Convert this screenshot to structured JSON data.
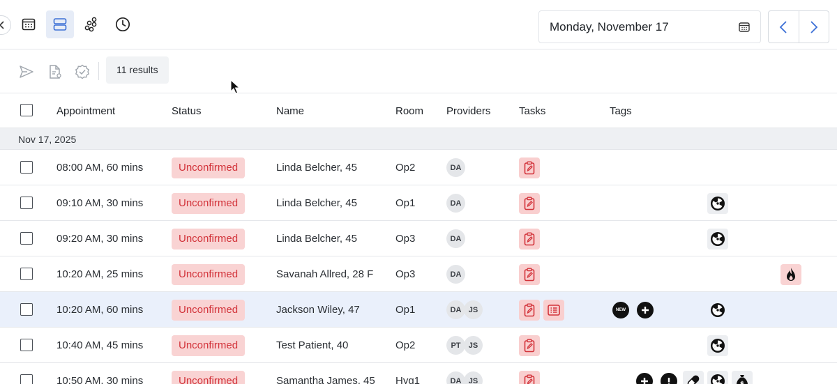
{
  "toolbar": {
    "date_label": "Monday, November 17"
  },
  "actions": {
    "results_label": "11 results"
  },
  "table": {
    "columns": [
      "Appointment",
      "Status",
      "Name",
      "Room",
      "Providers",
      "Tasks",
      "Tags"
    ],
    "group_label": "Nov 17, 2025",
    "rows": [
      {
        "appointment": "08:00 AM, 60 mins",
        "status": "Unconfirmed",
        "name": "Linda Belcher, 45",
        "room": "Op2",
        "providers": [
          "DA"
        ]
      },
      {
        "appointment": "09:10 AM, 30 mins",
        "status": "Unconfirmed",
        "name": "Linda Belcher, 45",
        "room": "Op1",
        "providers": [
          "DA"
        ]
      },
      {
        "appointment": "09:20 AM, 30 mins",
        "status": "Unconfirmed",
        "name": "Linda Belcher, 45",
        "room": "Op3",
        "providers": [
          "DA"
        ]
      },
      {
        "appointment": "10:20 AM, 25 mins",
        "status": "Unconfirmed",
        "name": "Savanah Allred, 28 F",
        "room": "Op3",
        "providers": [
          "DA"
        ]
      },
      {
        "appointment": "10:20 AM, 60 mins",
        "status": "Unconfirmed",
        "name": "Jackson Wiley, 47",
        "room": "Op1",
        "providers": [
          "DA",
          "JS"
        ]
      },
      {
        "appointment": "10:40 AM, 45 mins",
        "status": "Unconfirmed",
        "name": "Test Patient, 40",
        "room": "Op2",
        "providers": [
          "PT",
          "JS"
        ]
      },
      {
        "appointment": "10:50 AM, 30 mins",
        "status": "Unconfirmed",
        "name": "Samantha James, 45",
        "room": "Hyg1",
        "providers": [
          "DA",
          "JS"
        ]
      }
    ],
    "new_tag_label": "NEW"
  },
  "colors": {
    "accent": "#3b6fd6",
    "status_bg": "#f9d3d3",
    "status_text": "#d2333a",
    "highlight_row": "#eaf0fb"
  },
  "icons": [
    "chevron-left-icon",
    "calendar-grid-icon",
    "list-view-icon",
    "group-view-icon",
    "clock-icon",
    "calendar-icon",
    "chevron-right-icon",
    "send-icon",
    "document-icon",
    "verified-icon",
    "clipboard-icon",
    "form-icon",
    "radiation-icon",
    "flame-icon",
    "plus-circle-icon",
    "alert-circle-icon",
    "pill-icon",
    "money-bag-icon",
    "new-badge-icon"
  ]
}
